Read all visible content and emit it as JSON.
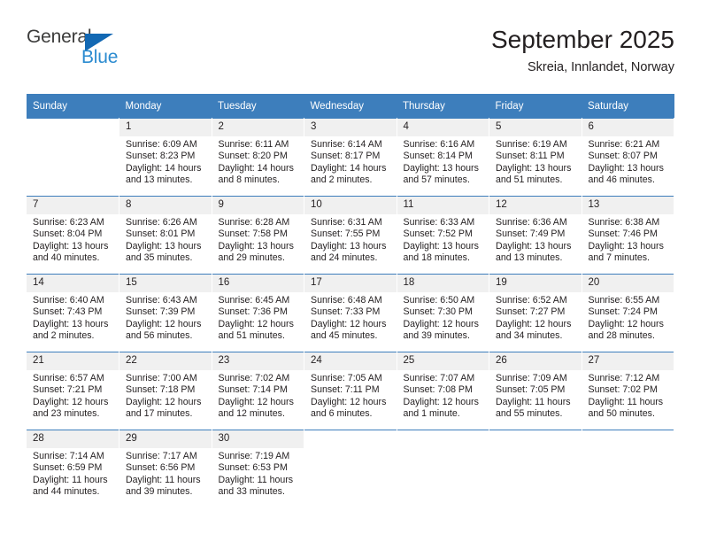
{
  "brand": {
    "name_part1": "General",
    "name_part2": "Blue",
    "triangle_icon": "triangle-icon",
    "colors": {
      "general": "#3c3c3b",
      "blue": "#2b8bd0",
      "triangle": "#1268b3"
    }
  },
  "header": {
    "title": "September 2025",
    "subtitle": "Skreia, Innlandet, Norway"
  },
  "theme": {
    "header_bar": "#3d7ebc",
    "daynum_band": "#f0f0f0",
    "text": "#231f20"
  },
  "weekdays": [
    "Sunday",
    "Monday",
    "Tuesday",
    "Wednesday",
    "Thursday",
    "Friday",
    "Saturday"
  ],
  "weeks": [
    [
      {
        "day": "",
        "sunrise": "",
        "sunset": "",
        "daylight1": "",
        "daylight2": ""
      },
      {
        "day": "1",
        "sunrise": "Sunrise: 6:09 AM",
        "sunset": "Sunset: 8:23 PM",
        "daylight1": "Daylight: 14 hours",
        "daylight2": "and 13 minutes."
      },
      {
        "day": "2",
        "sunrise": "Sunrise: 6:11 AM",
        "sunset": "Sunset: 8:20 PM",
        "daylight1": "Daylight: 14 hours",
        "daylight2": "and 8 minutes."
      },
      {
        "day": "3",
        "sunrise": "Sunrise: 6:14 AM",
        "sunset": "Sunset: 8:17 PM",
        "daylight1": "Daylight: 14 hours",
        "daylight2": "and 2 minutes."
      },
      {
        "day": "4",
        "sunrise": "Sunrise: 6:16 AM",
        "sunset": "Sunset: 8:14 PM",
        "daylight1": "Daylight: 13 hours",
        "daylight2": "and 57 minutes."
      },
      {
        "day": "5",
        "sunrise": "Sunrise: 6:19 AM",
        "sunset": "Sunset: 8:11 PM",
        "daylight1": "Daylight: 13 hours",
        "daylight2": "and 51 minutes."
      },
      {
        "day": "6",
        "sunrise": "Sunrise: 6:21 AM",
        "sunset": "Sunset: 8:07 PM",
        "daylight1": "Daylight: 13 hours",
        "daylight2": "and 46 minutes."
      }
    ],
    [
      {
        "day": "7",
        "sunrise": "Sunrise: 6:23 AM",
        "sunset": "Sunset: 8:04 PM",
        "daylight1": "Daylight: 13 hours",
        "daylight2": "and 40 minutes."
      },
      {
        "day": "8",
        "sunrise": "Sunrise: 6:26 AM",
        "sunset": "Sunset: 8:01 PM",
        "daylight1": "Daylight: 13 hours",
        "daylight2": "and 35 minutes."
      },
      {
        "day": "9",
        "sunrise": "Sunrise: 6:28 AM",
        "sunset": "Sunset: 7:58 PM",
        "daylight1": "Daylight: 13 hours",
        "daylight2": "and 29 minutes."
      },
      {
        "day": "10",
        "sunrise": "Sunrise: 6:31 AM",
        "sunset": "Sunset: 7:55 PM",
        "daylight1": "Daylight: 13 hours",
        "daylight2": "and 24 minutes."
      },
      {
        "day": "11",
        "sunrise": "Sunrise: 6:33 AM",
        "sunset": "Sunset: 7:52 PM",
        "daylight1": "Daylight: 13 hours",
        "daylight2": "and 18 minutes."
      },
      {
        "day": "12",
        "sunrise": "Sunrise: 6:36 AM",
        "sunset": "Sunset: 7:49 PM",
        "daylight1": "Daylight: 13 hours",
        "daylight2": "and 13 minutes."
      },
      {
        "day": "13",
        "sunrise": "Sunrise: 6:38 AM",
        "sunset": "Sunset: 7:46 PM",
        "daylight1": "Daylight: 13 hours",
        "daylight2": "and 7 minutes."
      }
    ],
    [
      {
        "day": "14",
        "sunrise": "Sunrise: 6:40 AM",
        "sunset": "Sunset: 7:43 PM",
        "daylight1": "Daylight: 13 hours",
        "daylight2": "and 2 minutes."
      },
      {
        "day": "15",
        "sunrise": "Sunrise: 6:43 AM",
        "sunset": "Sunset: 7:39 PM",
        "daylight1": "Daylight: 12 hours",
        "daylight2": "and 56 minutes."
      },
      {
        "day": "16",
        "sunrise": "Sunrise: 6:45 AM",
        "sunset": "Sunset: 7:36 PM",
        "daylight1": "Daylight: 12 hours",
        "daylight2": "and 51 minutes."
      },
      {
        "day": "17",
        "sunrise": "Sunrise: 6:48 AM",
        "sunset": "Sunset: 7:33 PM",
        "daylight1": "Daylight: 12 hours",
        "daylight2": "and 45 minutes."
      },
      {
        "day": "18",
        "sunrise": "Sunrise: 6:50 AM",
        "sunset": "Sunset: 7:30 PM",
        "daylight1": "Daylight: 12 hours",
        "daylight2": "and 39 minutes."
      },
      {
        "day": "19",
        "sunrise": "Sunrise: 6:52 AM",
        "sunset": "Sunset: 7:27 PM",
        "daylight1": "Daylight: 12 hours",
        "daylight2": "and 34 minutes."
      },
      {
        "day": "20",
        "sunrise": "Sunrise: 6:55 AM",
        "sunset": "Sunset: 7:24 PM",
        "daylight1": "Daylight: 12 hours",
        "daylight2": "and 28 minutes."
      }
    ],
    [
      {
        "day": "21",
        "sunrise": "Sunrise: 6:57 AM",
        "sunset": "Sunset: 7:21 PM",
        "daylight1": "Daylight: 12 hours",
        "daylight2": "and 23 minutes."
      },
      {
        "day": "22",
        "sunrise": "Sunrise: 7:00 AM",
        "sunset": "Sunset: 7:18 PM",
        "daylight1": "Daylight: 12 hours",
        "daylight2": "and 17 minutes."
      },
      {
        "day": "23",
        "sunrise": "Sunrise: 7:02 AM",
        "sunset": "Sunset: 7:14 PM",
        "daylight1": "Daylight: 12 hours",
        "daylight2": "and 12 minutes."
      },
      {
        "day": "24",
        "sunrise": "Sunrise: 7:05 AM",
        "sunset": "Sunset: 7:11 PM",
        "daylight1": "Daylight: 12 hours",
        "daylight2": "and 6 minutes."
      },
      {
        "day": "25",
        "sunrise": "Sunrise: 7:07 AM",
        "sunset": "Sunset: 7:08 PM",
        "daylight1": "Daylight: 12 hours",
        "daylight2": "and 1 minute."
      },
      {
        "day": "26",
        "sunrise": "Sunrise: 7:09 AM",
        "sunset": "Sunset: 7:05 PM",
        "daylight1": "Daylight: 11 hours",
        "daylight2": "and 55 minutes."
      },
      {
        "day": "27",
        "sunrise": "Sunrise: 7:12 AM",
        "sunset": "Sunset: 7:02 PM",
        "daylight1": "Daylight: 11 hours",
        "daylight2": "and 50 minutes."
      }
    ],
    [
      {
        "day": "28",
        "sunrise": "Sunrise: 7:14 AM",
        "sunset": "Sunset: 6:59 PM",
        "daylight1": "Daylight: 11 hours",
        "daylight2": "and 44 minutes."
      },
      {
        "day": "29",
        "sunrise": "Sunrise: 7:17 AM",
        "sunset": "Sunset: 6:56 PM",
        "daylight1": "Daylight: 11 hours",
        "daylight2": "and 39 minutes."
      },
      {
        "day": "30",
        "sunrise": "Sunrise: 7:19 AM",
        "sunset": "Sunset: 6:53 PM",
        "daylight1": "Daylight: 11 hours",
        "daylight2": "and 33 minutes."
      },
      {
        "day": "",
        "sunrise": "",
        "sunset": "",
        "daylight1": "",
        "daylight2": ""
      },
      {
        "day": "",
        "sunrise": "",
        "sunset": "",
        "daylight1": "",
        "daylight2": ""
      },
      {
        "day": "",
        "sunrise": "",
        "sunset": "",
        "daylight1": "",
        "daylight2": ""
      },
      {
        "day": "",
        "sunrise": "",
        "sunset": "",
        "daylight1": "",
        "daylight2": ""
      }
    ]
  ]
}
